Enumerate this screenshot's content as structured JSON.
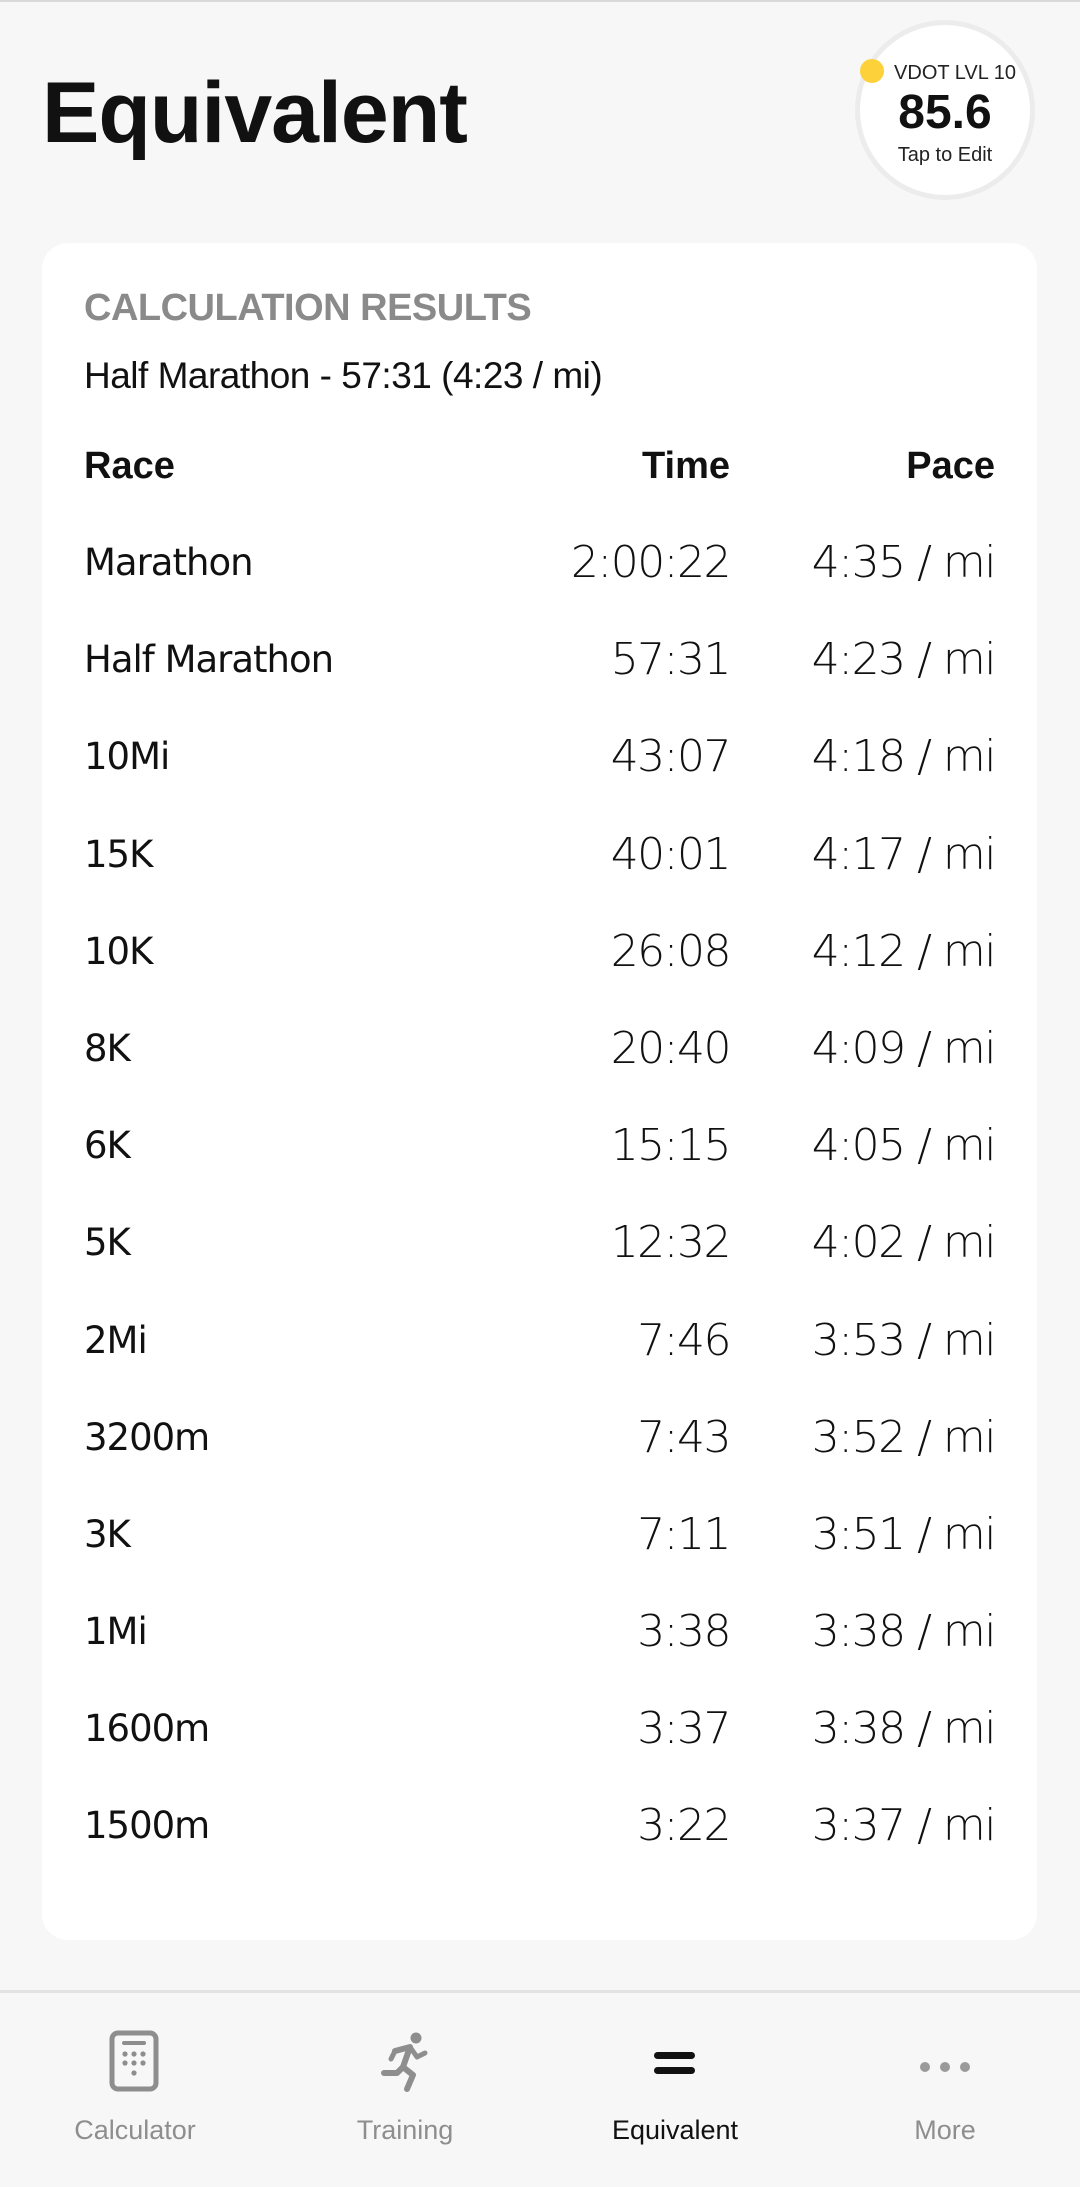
{
  "header": {
    "title": "Equivalent"
  },
  "vdot_badge": {
    "level_label": "VDOT LVL 10",
    "value": "85.6",
    "action_label": "Tap to Edit",
    "dot_color": "#fdd13a"
  },
  "results": {
    "section_title": "CALCULATION RESULTS",
    "input_summary": "Half Marathon - 57:31 (4:23 / mi)",
    "columns": {
      "race": "Race",
      "time": "Time",
      "pace": "Pace"
    },
    "rows": [
      {
        "race": "Marathon",
        "time": "2:00:22",
        "pace": "4:35 / mi"
      },
      {
        "race": "Half Marathon",
        "time": "57:31",
        "pace": "4:23 / mi"
      },
      {
        "race": "10Mi",
        "time": "43:07",
        "pace": "4:18 / mi"
      },
      {
        "race": "15K",
        "time": "40:01",
        "pace": "4:17 / mi"
      },
      {
        "race": "10K",
        "time": "26:08",
        "pace": "4:12 / mi"
      },
      {
        "race": "8K",
        "time": "20:40",
        "pace": "4:09 / mi"
      },
      {
        "race": "6K",
        "time": "15:15",
        "pace": "4:05 / mi"
      },
      {
        "race": "5K",
        "time": "12:32",
        "pace": "4:02 / mi"
      },
      {
        "race": "2Mi",
        "time": "7:46",
        "pace": "3:53 / mi"
      },
      {
        "race": "3200m",
        "time": "7:43",
        "pace": "3:52 / mi"
      },
      {
        "race": "3K",
        "time": "7:11",
        "pace": "3:51 / mi"
      },
      {
        "race": "1Mi",
        "time": "3:38",
        "pace": "3:38 / mi"
      },
      {
        "race": "1600m",
        "time": "3:37",
        "pace": "3:38 / mi"
      },
      {
        "race": "1500m",
        "time": "3:22",
        "pace": "3:37 / mi"
      }
    ]
  },
  "tabbar": {
    "tabs": [
      {
        "label": "Calculator",
        "icon": "calculator-icon",
        "active": false
      },
      {
        "label": "Training",
        "icon": "runner-icon",
        "active": false
      },
      {
        "label": "Equivalent",
        "icon": "equals-icon",
        "active": true
      },
      {
        "label": "More",
        "icon": "more-dots-icon",
        "active": false
      }
    ],
    "active_color": "#111111",
    "inactive_color": "#8e8e8e"
  }
}
